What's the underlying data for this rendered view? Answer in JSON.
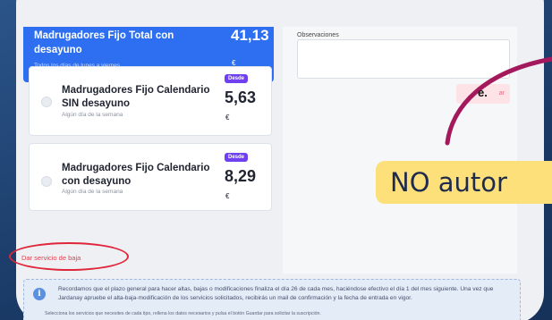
{
  "selected_card": {
    "name": "Madrugadores Fijo Total con desayuno",
    "subtitle": "Todos los días de lunes a viernes",
    "price": "41,13",
    "currency": "€"
  },
  "cards": [
    {
      "name": "Madrugadores Fijo Calendario SIN desayuno",
      "subtitle": "Algún día de la semana",
      "badge": "Desde",
      "price": "5,63",
      "currency": "€"
    },
    {
      "name": "Madrugadores Fijo Calendario con desayuno",
      "subtitle": "Algún día de la semana",
      "badge": "Desde",
      "price": "8,29",
      "currency": "€"
    }
  ],
  "observations": {
    "label": "Observaciones",
    "pink_button_label": "ar"
  },
  "baja_link": "Dar servicio de baja",
  "info_text": "Recordamos que el plazo general para hacer altas, bajas o modificaciones finaliza el día 26 de cada mes, haciéndose efectivo el día 1 del mes siguiente. Una vez que Jardanay apruebe el alta-baja-modificación de los servicios solicitados, recibirás un mail de confirmación y la fecha de entrada en vigor.",
  "bottom_text": "Selecciona los servicios que necesites de cada tipo, rellena los datos necesarios y pulsa el botón Guardar para solicitar la suscripción.",
  "annotation": {
    "e_label": "e.",
    "bubble_text": "NO autor",
    "circle_color": "#e0263a",
    "arc_color": "#a3195b",
    "bubble_color": "#fde07a"
  }
}
